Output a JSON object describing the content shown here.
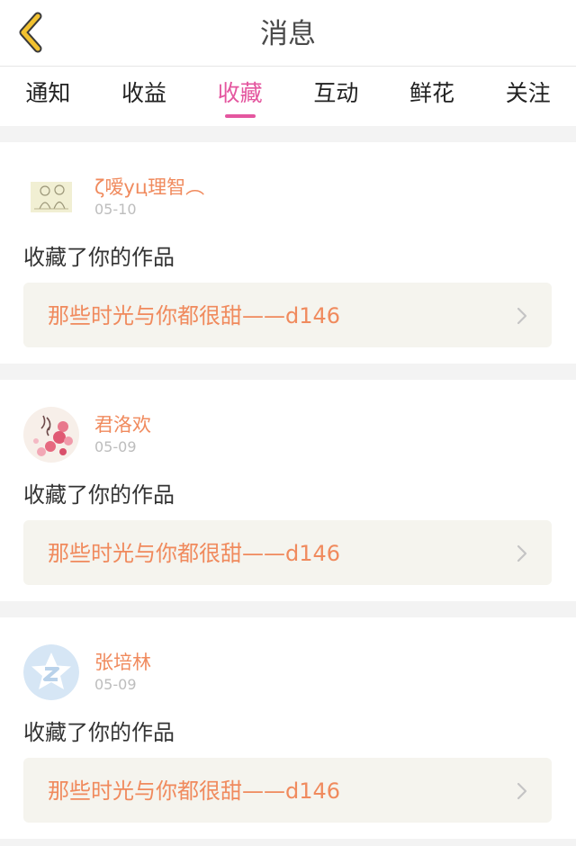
{
  "header": {
    "title": "消息",
    "back_icon": "chevron-left-icon",
    "back_color": "#f2c230"
  },
  "tabs": [
    {
      "label": "通知",
      "active": false
    },
    {
      "label": "收益",
      "active": false
    },
    {
      "label": "收藏",
      "active": true
    },
    {
      "label": "互动",
      "active": false
    },
    {
      "label": "鲜花",
      "active": false
    },
    {
      "label": "关注",
      "active": false
    }
  ],
  "colors": {
    "accent": "#e4569f",
    "username": "#f08a5d",
    "link_bg": "#f5f4ee"
  },
  "notifications": [
    {
      "username": "ζ嗳yц理智︵",
      "date": "05-10",
      "action": "收藏了你的作品",
      "work_title": "那些时光与你都很甜——d146",
      "avatar": "sketch-avatar"
    },
    {
      "username": "君洛欢",
      "date": "05-09",
      "action": "收藏了你的作品",
      "work_title": "那些时光与你都很甜——d146",
      "avatar": "flower-avatar"
    },
    {
      "username": "张培林",
      "date": "05-09",
      "action": "收藏了你的作品",
      "work_title": "那些时光与你都很甜——d146",
      "avatar": "qq-star-avatar"
    }
  ]
}
